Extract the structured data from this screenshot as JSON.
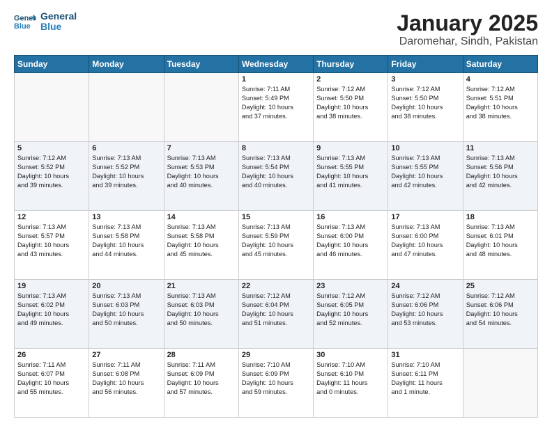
{
  "header": {
    "logo_general": "General",
    "logo_blue": "Blue",
    "month": "January 2025",
    "location": "Daromehar, Sindh, Pakistan"
  },
  "weekdays": [
    "Sunday",
    "Monday",
    "Tuesday",
    "Wednesday",
    "Thursday",
    "Friday",
    "Saturday"
  ],
  "weeks": [
    [
      {
        "day": "",
        "text": ""
      },
      {
        "day": "",
        "text": ""
      },
      {
        "day": "",
        "text": ""
      },
      {
        "day": "1",
        "text": "Sunrise: 7:11 AM\nSunset: 5:49 PM\nDaylight: 10 hours\nand 37 minutes."
      },
      {
        "day": "2",
        "text": "Sunrise: 7:12 AM\nSunset: 5:50 PM\nDaylight: 10 hours\nand 38 minutes."
      },
      {
        "day": "3",
        "text": "Sunrise: 7:12 AM\nSunset: 5:50 PM\nDaylight: 10 hours\nand 38 minutes."
      },
      {
        "day": "4",
        "text": "Sunrise: 7:12 AM\nSunset: 5:51 PM\nDaylight: 10 hours\nand 38 minutes."
      }
    ],
    [
      {
        "day": "5",
        "text": "Sunrise: 7:12 AM\nSunset: 5:52 PM\nDaylight: 10 hours\nand 39 minutes."
      },
      {
        "day": "6",
        "text": "Sunrise: 7:13 AM\nSunset: 5:52 PM\nDaylight: 10 hours\nand 39 minutes."
      },
      {
        "day": "7",
        "text": "Sunrise: 7:13 AM\nSunset: 5:53 PM\nDaylight: 10 hours\nand 40 minutes."
      },
      {
        "day": "8",
        "text": "Sunrise: 7:13 AM\nSunset: 5:54 PM\nDaylight: 10 hours\nand 40 minutes."
      },
      {
        "day": "9",
        "text": "Sunrise: 7:13 AM\nSunset: 5:55 PM\nDaylight: 10 hours\nand 41 minutes."
      },
      {
        "day": "10",
        "text": "Sunrise: 7:13 AM\nSunset: 5:55 PM\nDaylight: 10 hours\nand 42 minutes."
      },
      {
        "day": "11",
        "text": "Sunrise: 7:13 AM\nSunset: 5:56 PM\nDaylight: 10 hours\nand 42 minutes."
      }
    ],
    [
      {
        "day": "12",
        "text": "Sunrise: 7:13 AM\nSunset: 5:57 PM\nDaylight: 10 hours\nand 43 minutes."
      },
      {
        "day": "13",
        "text": "Sunrise: 7:13 AM\nSunset: 5:58 PM\nDaylight: 10 hours\nand 44 minutes."
      },
      {
        "day": "14",
        "text": "Sunrise: 7:13 AM\nSunset: 5:58 PM\nDaylight: 10 hours\nand 45 minutes."
      },
      {
        "day": "15",
        "text": "Sunrise: 7:13 AM\nSunset: 5:59 PM\nDaylight: 10 hours\nand 45 minutes."
      },
      {
        "day": "16",
        "text": "Sunrise: 7:13 AM\nSunset: 6:00 PM\nDaylight: 10 hours\nand 46 minutes."
      },
      {
        "day": "17",
        "text": "Sunrise: 7:13 AM\nSunset: 6:00 PM\nDaylight: 10 hours\nand 47 minutes."
      },
      {
        "day": "18",
        "text": "Sunrise: 7:13 AM\nSunset: 6:01 PM\nDaylight: 10 hours\nand 48 minutes."
      }
    ],
    [
      {
        "day": "19",
        "text": "Sunrise: 7:13 AM\nSunset: 6:02 PM\nDaylight: 10 hours\nand 49 minutes."
      },
      {
        "day": "20",
        "text": "Sunrise: 7:13 AM\nSunset: 6:03 PM\nDaylight: 10 hours\nand 50 minutes."
      },
      {
        "day": "21",
        "text": "Sunrise: 7:13 AM\nSunset: 6:03 PM\nDaylight: 10 hours\nand 50 minutes."
      },
      {
        "day": "22",
        "text": "Sunrise: 7:12 AM\nSunset: 6:04 PM\nDaylight: 10 hours\nand 51 minutes."
      },
      {
        "day": "23",
        "text": "Sunrise: 7:12 AM\nSunset: 6:05 PM\nDaylight: 10 hours\nand 52 minutes."
      },
      {
        "day": "24",
        "text": "Sunrise: 7:12 AM\nSunset: 6:06 PM\nDaylight: 10 hours\nand 53 minutes."
      },
      {
        "day": "25",
        "text": "Sunrise: 7:12 AM\nSunset: 6:06 PM\nDaylight: 10 hours\nand 54 minutes."
      }
    ],
    [
      {
        "day": "26",
        "text": "Sunrise: 7:11 AM\nSunset: 6:07 PM\nDaylight: 10 hours\nand 55 minutes."
      },
      {
        "day": "27",
        "text": "Sunrise: 7:11 AM\nSunset: 6:08 PM\nDaylight: 10 hours\nand 56 minutes."
      },
      {
        "day": "28",
        "text": "Sunrise: 7:11 AM\nSunset: 6:09 PM\nDaylight: 10 hours\nand 57 minutes."
      },
      {
        "day": "29",
        "text": "Sunrise: 7:10 AM\nSunset: 6:09 PM\nDaylight: 10 hours\nand 59 minutes."
      },
      {
        "day": "30",
        "text": "Sunrise: 7:10 AM\nSunset: 6:10 PM\nDaylight: 11 hours\nand 0 minutes."
      },
      {
        "day": "31",
        "text": "Sunrise: 7:10 AM\nSunset: 6:11 PM\nDaylight: 11 hours\nand 1 minute."
      },
      {
        "day": "",
        "text": ""
      }
    ]
  ]
}
